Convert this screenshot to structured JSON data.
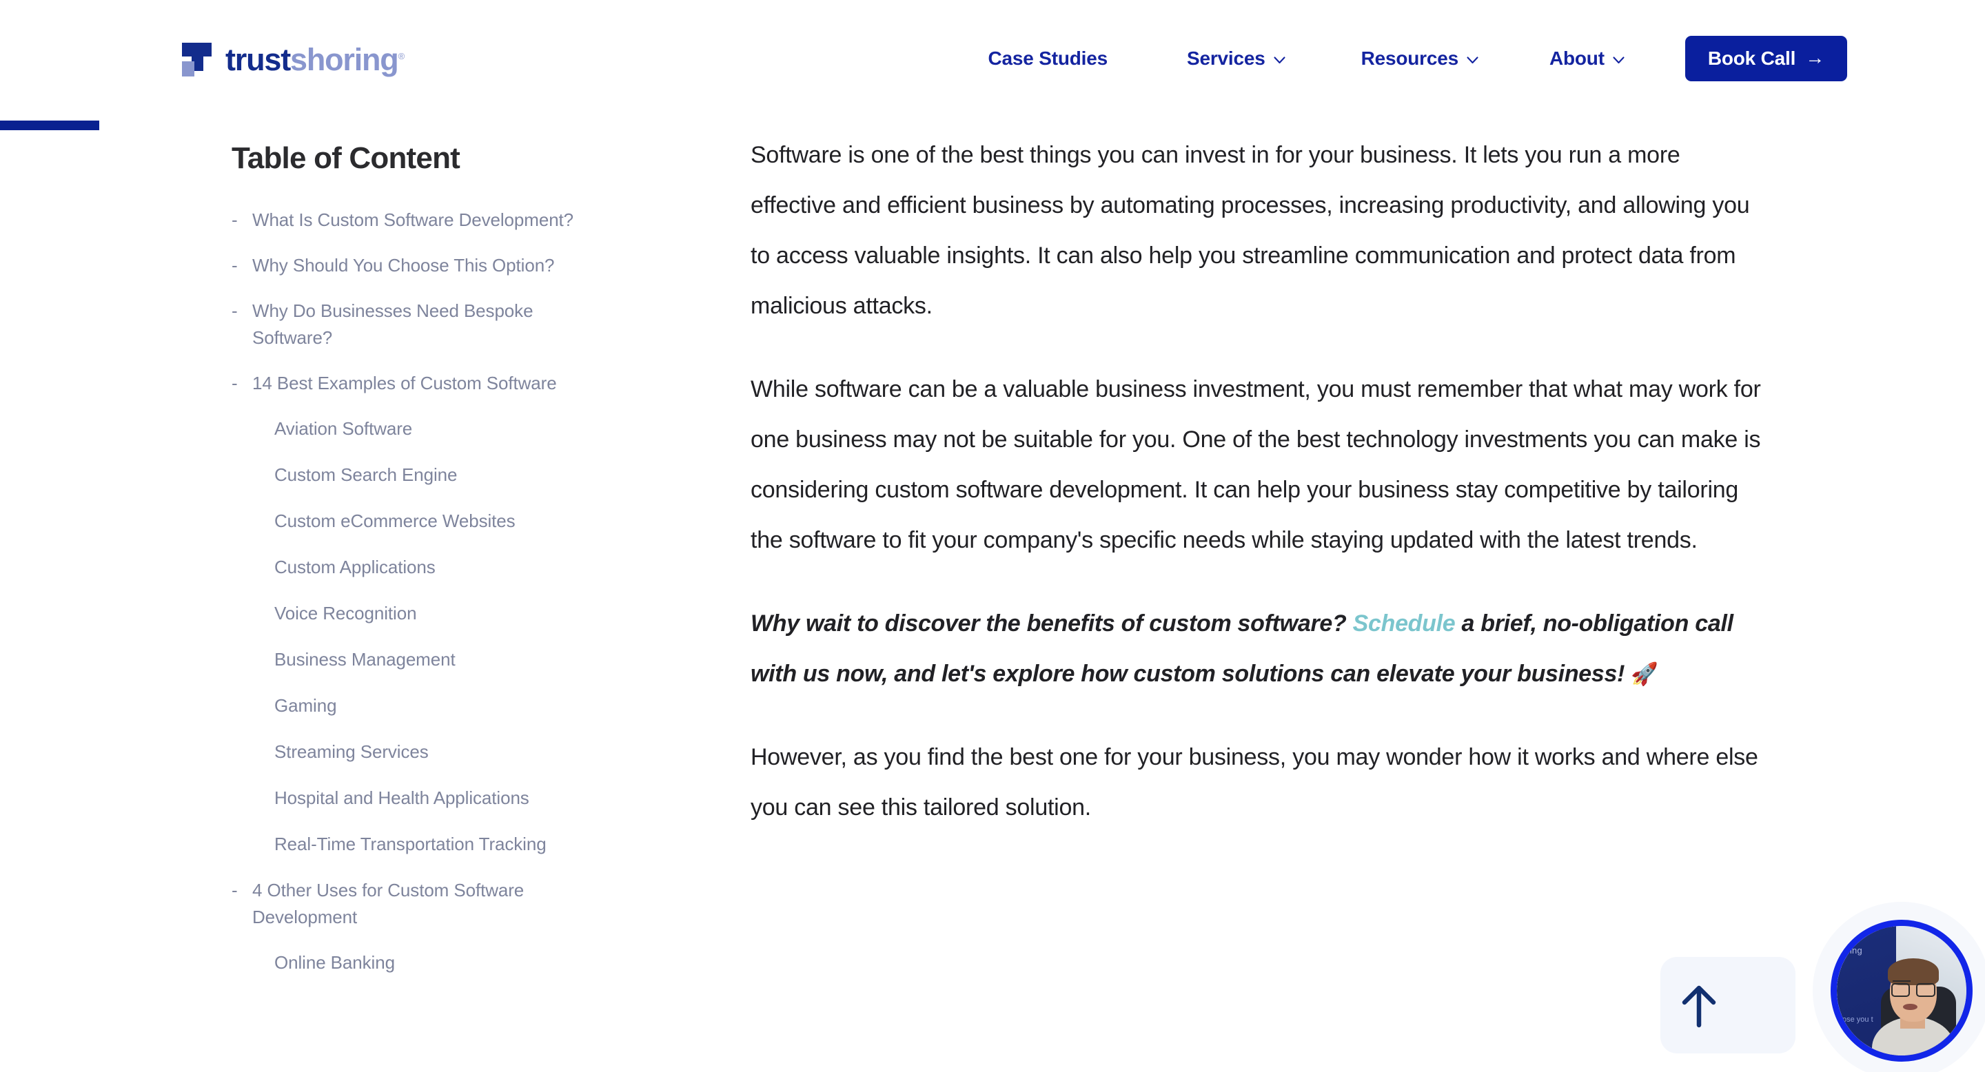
{
  "header": {
    "logo": {
      "text_primary": "trust",
      "text_secondary": "shoring",
      "registered_mark": "®"
    },
    "nav": [
      {
        "label": "Case Studies",
        "has_dropdown": false
      },
      {
        "label": "Services",
        "has_dropdown": true
      },
      {
        "label": "Resources",
        "has_dropdown": true
      },
      {
        "label": "About",
        "has_dropdown": true
      }
    ],
    "cta": {
      "label": "Book Call",
      "arrow": "→"
    }
  },
  "reading_progress": {
    "percent": 5
  },
  "toc": {
    "title": "Table of Content",
    "items": [
      {
        "label": "What Is Custom Software Development?",
        "level": 1
      },
      {
        "label": "Why Should You Choose This Option?",
        "level": 1
      },
      {
        "label": "Why Do Businesses Need Bespoke Software?",
        "level": 1
      },
      {
        "label": "14 Best Examples of Custom Software",
        "level": 1
      },
      {
        "label": "Aviation Software",
        "level": 2
      },
      {
        "label": "Custom Search Engine",
        "level": 2
      },
      {
        "label": "Custom eCommerce Websites",
        "level": 2
      },
      {
        "label": "Custom Applications",
        "level": 2
      },
      {
        "label": "Voice Recognition",
        "level": 2
      },
      {
        "label": "Business Management",
        "level": 2
      },
      {
        "label": "Gaming",
        "level": 2
      },
      {
        "label": "Streaming Services",
        "level": 2
      },
      {
        "label": "Hospital and Health Applications",
        "level": 2
      },
      {
        "label": "Real-Time Transportation Tracking",
        "level": 2
      },
      {
        "label": "4 Other Uses for Custom Software Development",
        "level": 1
      },
      {
        "label": "Online Banking",
        "level": 2
      }
    ],
    "dash": "-"
  },
  "article": {
    "p1": "Software is one of the best things you can invest in for your business. It lets you run a more effective and efficient business by automating processes, increasing productivity, and allowing you to access valuable insights. It can also help you streamline communication and protect data from malicious attacks.",
    "p2": "While software can be a valuable business investment, you must remember that what may work for one business may not be suitable for you. One of the best technology investments you can make is considering custom software development. It can help your business stay competitive by tailoring the software to fit your company's specific needs while staying updated with the latest trends.",
    "cta_before": "Why wait to discover the benefits of custom software? ",
    "cta_link": "Schedule",
    "cta_after": " a brief, no-obligation call with us now, and let's explore how custom solutions can elevate your business! ",
    "cta_emoji": "🚀",
    "p4": "However, as you find the best one for your business, you may wonder how it works and where else you can see this tailored solution."
  },
  "widgets": {
    "back_to_top": {
      "icon": "arrow-up-icon"
    },
    "video_bubble": {
      "slide_text_top": "oring",
      "slide_text_bottom": "ose you t"
    }
  },
  "colors": {
    "brand_navy": "#132C8C",
    "brand_light": "#8996CE",
    "nav_blue": "#1424A0",
    "cta_button": "#0A1F9E",
    "progress": "#0A2190",
    "toc_text": "#7E849C",
    "body_text": "#212125",
    "link_teal": "#7BC5CD",
    "bubble_ring": "#1226E8",
    "back_to_top_bg": "#F3F6FC"
  }
}
